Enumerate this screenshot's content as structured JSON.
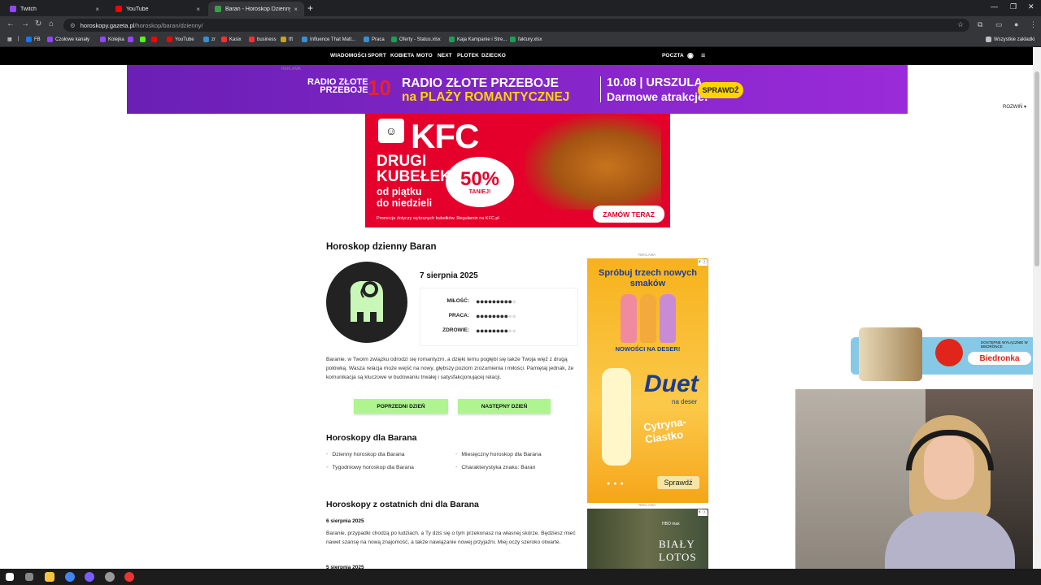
{
  "browser": {
    "tabs": [
      {
        "label": "Twitch",
        "color": "#9146ff"
      },
      {
        "label": "YouTube",
        "color": "#ff0000"
      },
      {
        "label": "Baran - Horoskop Dzienny - Ho",
        "color": "#3a9f48"
      }
    ],
    "new_tab": "+",
    "url_domain": "horoskopy.gazeta.pl",
    "url_path": "/horoskop/baran/dzienny/",
    "bookmarks": [
      {
        "label": "FB",
        "color": "#1877f2"
      },
      {
        "label": "Czołowe kanały",
        "color": "#9146ff"
      },
      {
        "label": "Kolejka",
        "color": "#9146ff"
      },
      {
        "label": "",
        "color": "#9146ff"
      },
      {
        "label": "",
        "color": "#53fc18"
      },
      {
        "label": "",
        "color": "#ff0000"
      },
      {
        "label": "YouTube",
        "color": "#ff0000"
      },
      {
        "label": "zr",
        "color": "#3b8ed0"
      },
      {
        "label": "Kasix",
        "color": "#e33"
      },
      {
        "label": "business",
        "color": "#e33"
      },
      {
        "label": "tft",
        "color": "#c9a227"
      },
      {
        "label": "Influence That Matt...",
        "color": "#3b8ed0"
      },
      {
        "label": "Praca",
        "color": "#3b8ed0"
      },
      {
        "label": "Oferty - Status.xlsx",
        "color": "#1f9d55"
      },
      {
        "label": "Kaja Kampanie i Stre...",
        "color": "#1f9d55"
      },
      {
        "label": "faktury.xlsx",
        "color": "#1f9d55"
      }
    ],
    "all_bookmarks": "Wszystkie zakładki"
  },
  "site_nav": {
    "items": [
      "WIADOMOŚCI",
      "SPORT",
      "KOBIETA",
      "MOTO",
      "NEXT",
      "PLOTEK",
      "DZIECKO"
    ],
    "poczta": "POCZTA"
  },
  "ads": {
    "label": "REKLAMA",
    "rozwin": "ROZWIŃ ▾",
    "radio": {
      "logo_line1": "RADIO ZŁOTE",
      "logo_line2": "PRZEBOJE",
      "number": "10",
      "line1": "RADIO ZŁOTE PRZEBOJE",
      "line2": "na PLAŻY ROMANTYCZNEJ",
      "date": "10.08 | URSZULA",
      "date2": "Darmowe atrakcje!",
      "cta": "SPRAWDŹ"
    },
    "kfc": {
      "logo": "KFC",
      "big": "DRUGI KUBEŁEK",
      "small1": "od piątku",
      "small2": "do niedzieli",
      "pct": "50%",
      "tanie": "TANIEJ!",
      "fine": "Promocja dotyczy wybranych kubełków. Regulamin na KFC.pl",
      "cta": "ZAMÓW TERAZ"
    },
    "duet": {
      "headline": "Spróbuj trzech nowych smaków",
      "new": "NOWOŚCI NA DESER!",
      "logo": "Duet",
      "sub": "na deser",
      "flavor": "Cytryna-Ciastko",
      "cta": "Sprawdź",
      "close": "× ⓘ"
    },
    "lotos": {
      "hbo": "HBO max",
      "title": "BIAŁY LOTOS",
      "close": "× ⓘ"
    },
    "biedronka": {
      "name": "Biedronka",
      "tag": "Codziennie niskie ceny",
      "top": "DOSTĘPNE WYŁĄCZNIE W BIEDRONCE"
    }
  },
  "horoscope": {
    "title": "Horoskop dzienny Baran",
    "date": "7 sierpnia 2025",
    "ratings": [
      {
        "label": "MIŁOŚĆ:",
        "value": 9,
        "max": 10
      },
      {
        "label": "PRACA:",
        "value": 8,
        "max": 10
      },
      {
        "label": "ZDROWIE:",
        "value": 8,
        "max": 10
      }
    ],
    "description": "Baranie, w Twoim związku odrodzi się romantyzm, a dzięki temu pogłębi się także Twoja więź z drugą połówką. Wasza relacja może wejść na nowy, głębszy poziom zrozumienia i miłości. Pamiętaj jednak, że komunikacja są kluczowe w budowaniu trwałej i satysfakcjonującej relacji.",
    "prev_btn": "POPRZEDNI DZIEŃ",
    "next_btn": "NASTĘPNY DZIEŃ"
  },
  "horoscopes_for": {
    "title": "Horoskopy dla Barana",
    "links": [
      "Dzienny horoskop dla Barana",
      "Miesięczny horoskop dla Barana",
      "Tygodniowy horoskop dla Barana",
      "Charakterystyka znaku: Baran"
    ]
  },
  "recent": {
    "title": "Horoskopy z ostatnich dni dla Barana",
    "entries": [
      {
        "date": "6 sierpnia 2025",
        "text": "Baranie, przypadki chodzą po ludziach, a Ty dziś się o tym przekonasz na własnej skórze. Będziesz mieć nawet szansę na nową znajomość, a także nawiązanie nowej przyjaźni. Miej oczy szeroko otwarte."
      },
      {
        "date": "5 sierpnia 2025",
        "text": ""
      }
    ]
  },
  "colors": {
    "accent_green": "#aef58f",
    "kfc_red": "#e4002b",
    "radio_purple": "#8a28cf"
  }
}
